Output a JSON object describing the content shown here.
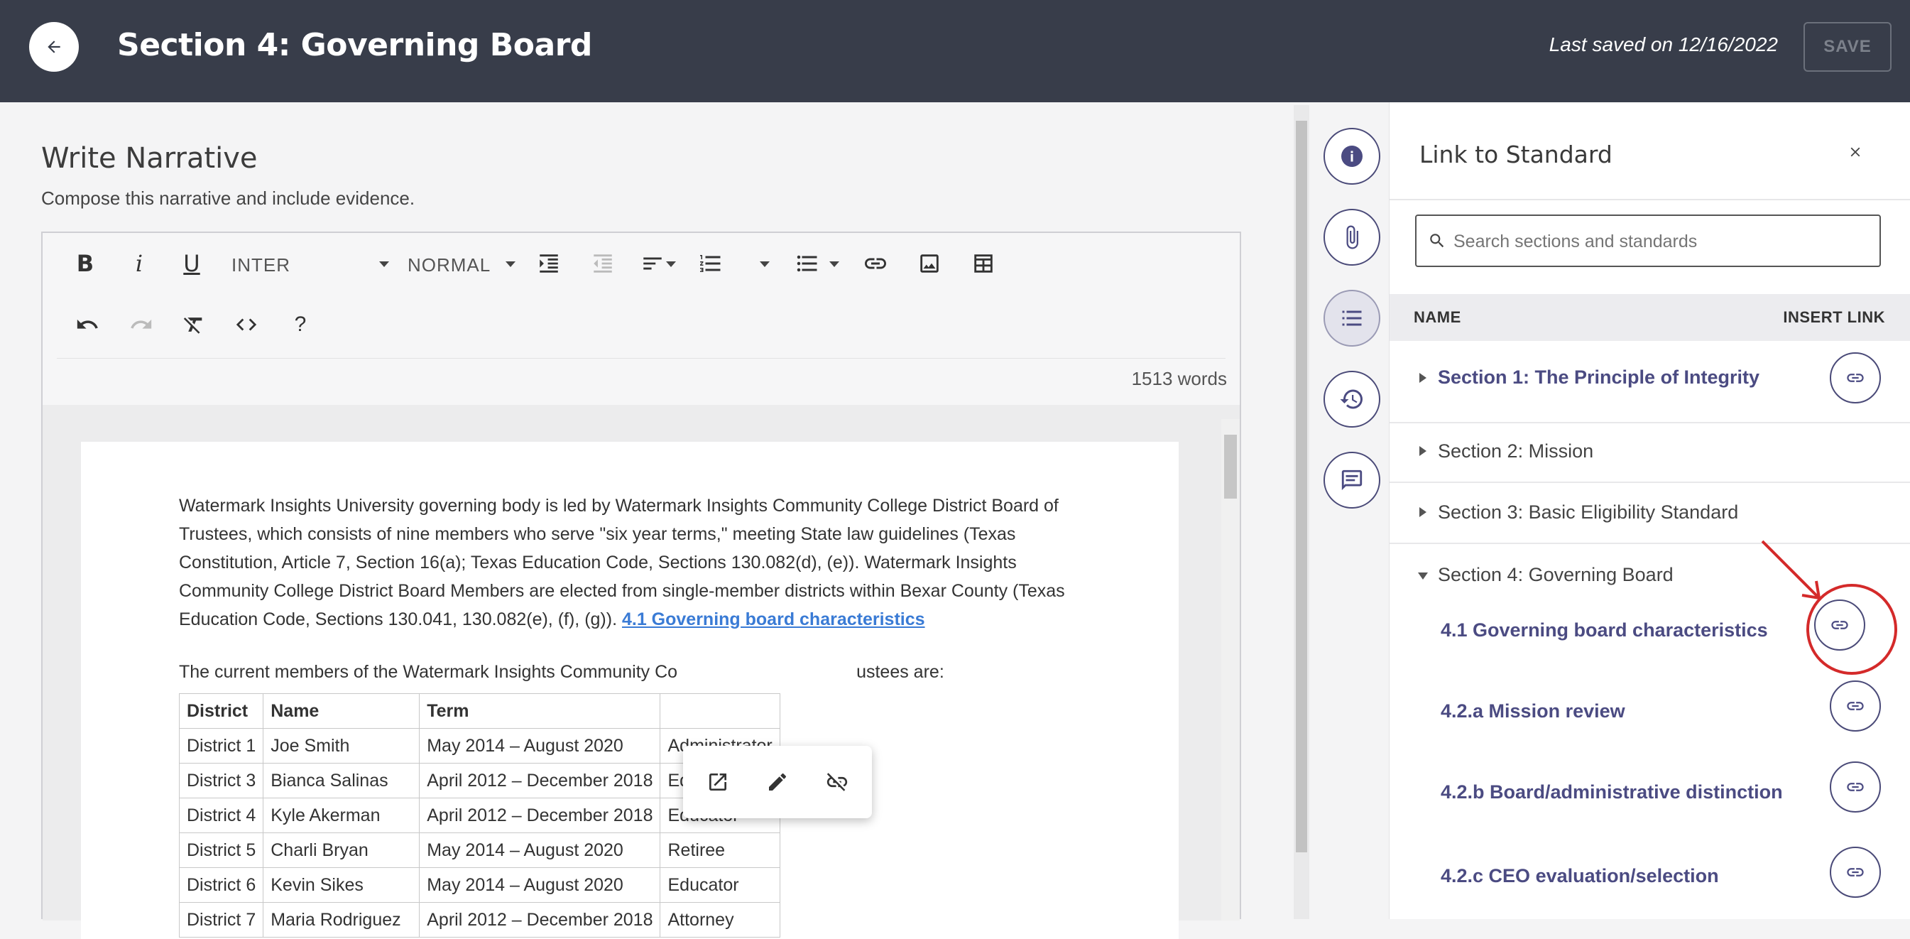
{
  "header": {
    "title": "Section 4: Governing Board",
    "last_saved": "Last saved on 12/16/2022",
    "save_label": "SAVE"
  },
  "narrative": {
    "title": "Write Narrative",
    "subtitle": "Compose this narrative and include evidence."
  },
  "toolbar": {
    "bold": "B",
    "italic": "i",
    "underline": "U",
    "font_select": "INTER",
    "size_select": "NORMAL",
    "help": "?",
    "word_count": "1513 words"
  },
  "document": {
    "paragraph1": "Watermark Insights University governing body is led by Watermark Insights Community College District Board of Trustees, which consists of nine members who serve \"six year terms,\" meeting State law guidelines (Texas Constitution, Article 7, Section 16(a); Texas Education Code, Sections 130.082(d), (e)). Watermark Insights Community College District Board Members are elected from single-member districts within Bexar County (Texas Education Code, Sections 130.041, 130.082(e), (f), (g)).",
    "inserted_link": "4.1 Governing board characteristics",
    "paragraph2_start": "The current members of the Watermark Insights Community Co",
    "paragraph2_end": "ustees are:",
    "table_headers": [
      "District",
      "Name",
      "Term",
      ""
    ],
    "table_rows": [
      [
        "District 1",
        "Joe Smith",
        "May 2014 – August 2020",
        "Administrator"
      ],
      [
        "District 3",
        "Bianca Salinas",
        "April 2012 – December 2018",
        "Educator"
      ],
      [
        "District 4",
        "Kyle Akerman",
        "April 2012 – December 2018",
        "Educator"
      ],
      [
        "District 5",
        "Charli Bryan",
        "May 2014 – August 2020",
        "Retiree"
      ],
      [
        "District 6",
        "Kevin Sikes",
        "May 2014 – August 2020",
        "Educator"
      ],
      [
        "District 7",
        "Maria Rodriguez",
        "April 2012 – December 2018",
        "Attorney"
      ]
    ]
  },
  "panel": {
    "title": "Link to Standard",
    "close": "×",
    "search_placeholder": "Search sections and standards",
    "col_name": "NAME",
    "col_insert": "INSERT LINK",
    "sections": [
      {
        "label": "Section 1: The Principle of Integrity"
      },
      {
        "label": "Section 2: Mission"
      },
      {
        "label": "Section 3: Basic Eligibility Standard"
      },
      {
        "label": "Section 4: Governing Board"
      }
    ],
    "standards": [
      {
        "label": "4.1 Governing board characteristics"
      },
      {
        "label": "4.2.a Mission review"
      },
      {
        "label": "4.2.b Board/administrative distinction"
      },
      {
        "label": "4.2.c CEO evaluation/selection"
      }
    ]
  },
  "colors": {
    "header_bg": "#383d4a",
    "accent": "#4b4b82",
    "link_blue": "#3a7bd5",
    "annotation_red": "#d42a2a"
  }
}
